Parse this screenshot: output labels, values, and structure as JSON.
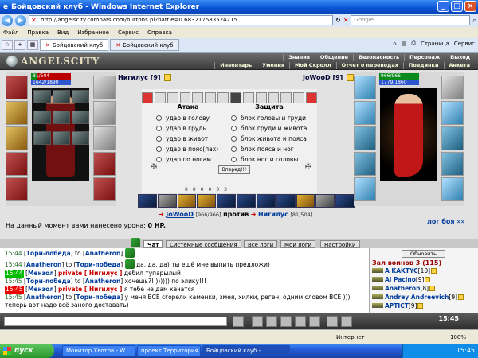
{
  "window": {
    "title": "Бойцовский клуб - Windows Internet Explorer",
    "min": "_",
    "max": "□",
    "close": "×"
  },
  "address": {
    "url": "http://angelscity.combats.com/buttons.pl?battle=0.683217583524215",
    "search_placeholder": "Google"
  },
  "menu": [
    "Файл",
    "Правка",
    "Вид",
    "Избранное",
    "Сервис",
    "Справка"
  ],
  "tabs": [
    {
      "label": "Бойцовский клуб"
    },
    {
      "label": "Бойцовский клуб"
    }
  ],
  "toolbar_right": {
    "page": "Страница",
    "tools": "Сервис"
  },
  "game_header": {
    "logo": "ANGELSCITY",
    "nav_top": [
      "Знания",
      "Общение",
      "Безопасность",
      "Персонаж",
      "Выход"
    ],
    "nav_bottom": [
      "Инвентарь",
      "Умения",
      "Мой Скролл",
      "Отчет о переводах",
      "Поединки",
      "Анкета"
    ]
  },
  "player_left": {
    "name": "Нигилус",
    "level": "[9]",
    "hp": "81/504",
    "mp": "1642/1890",
    "hp_fraction": 0.16
  },
  "player_right": {
    "name": "JoWooD",
    "level": "[9]",
    "hp": "966/966",
    "mp": "1779/1860",
    "hp_fraction": 1.0
  },
  "combat": {
    "attack_title": "Атака",
    "defense_title": "Защита",
    "attack_options": [
      "удар в голову",
      "удар в грудь",
      "удар в живот",
      "удар в пояс(пах)",
      "удар по ногам"
    ],
    "defense_options": [
      "блок головы и груди",
      "блок груди и живота",
      "блок живота и пояса",
      "блок пояса и ног",
      "блок ног и головы"
    ],
    "forward_button": "Вперед!!!",
    "stats": [
      "0",
      "0",
      "0",
      "0",
      "0",
      "3"
    ]
  },
  "versus": {
    "player_a": "JoWooD",
    "player_a_hp": "[966/966]",
    "word": "против",
    "player_b": "Нигилус",
    "player_b_hp": "[81/504]"
  },
  "damage_text": "На данный момент вами нанесено урона:",
  "damage_value": "0 HP.",
  "battle_log_link": "лог боя »»",
  "chat_tabs": [
    "Чат",
    "Системные сообщения",
    "Все логи",
    "Мои логи",
    "Настройки"
  ],
  "chat_lines": [
    {
      "time": "15:44",
      "from": "Тори-победа",
      "to_word": "to",
      "to": "Anatheron",
      "private": "",
      "text": ""
    },
    {
      "time": "15:44",
      "from": "Anatheron",
      "to_word": "to",
      "to": "Тори-победа",
      "private": "",
      "text": "да, да, да) ты ещё мне выпить предложи)"
    },
    {
      "time": "15:44",
      "from": "Мензол",
      "to_word": "",
      "to": "",
      "private": "private [ Нигилус ]",
      "text": "дебил тупарылый"
    },
    {
      "time": "15:45",
      "from": "Тори-победа",
      "to_word": "to",
      "to": "Anatheron",
      "private": "",
      "text": "хочешь?! )))))) по элику!!!"
    },
    {
      "time": "15:45",
      "from": "Мензол",
      "to_word": "",
      "to": "",
      "private": "private [ Нигилус ]",
      "text": "я тебе не дам качатся"
    },
    {
      "time": "15:45",
      "from": "Anatheron",
      "to_word": "to",
      "to": "Тори-победа",
      "private": "",
      "text": "у меня ВСЕ сгорели каменки, змея, хилки, реген, одним словом ВСЕ )))"
    },
    {
      "time": "",
      "from": "",
      "to_word": "",
      "to": "",
      "private": "",
      "text": "теперь вот надо всё заного доставать)"
    }
  ],
  "online": {
    "refresh_button": "Обновить",
    "hall": "Зал воинов 3 (115)",
    "users": [
      {
        "name": "A KAKTYC",
        "level": "[10]"
      },
      {
        "name": "Al Pacino",
        "level": "[9]"
      },
      {
        "name": "Anatheron",
        "level": "[8]"
      },
      {
        "name": "Andrey Andreevich",
        "level": "[9]"
      },
      {
        "name": "APTICT",
        "level": "[9]"
      }
    ]
  },
  "game_clock": "15:45",
  "status": {
    "internet": "Интернет",
    "zoom": "100%"
  },
  "taskbar": {
    "start": "пуск",
    "tasks": [
      "Монитор Хвотов - W...",
      "проект Территория ...",
      "Бойцовский клуб - ..."
    ],
    "clock": "15:45"
  }
}
